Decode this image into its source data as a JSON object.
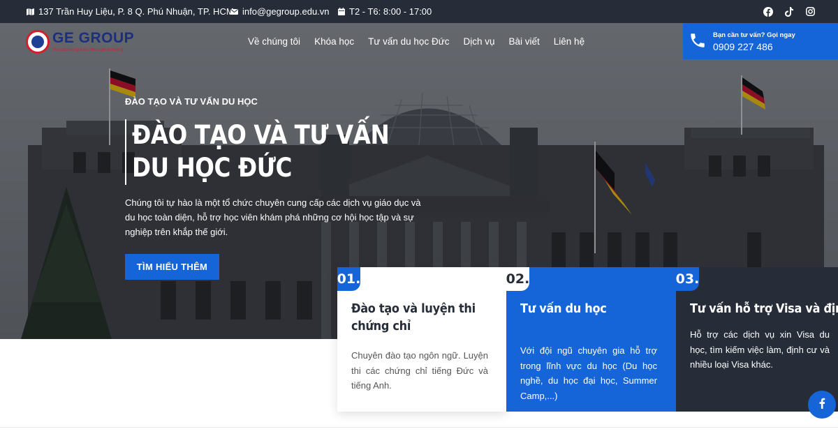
{
  "topbar": {
    "address": "137 Trần Huy Liệu, P. 8 Q. Phú Nhuận, TP. HCM",
    "email": "info@gegroup.edu.vn",
    "hours": "T2 - T6: 8:00 - 17:00",
    "social": [
      "facebook-icon",
      "tiktok-icon",
      "instagram-icon"
    ]
  },
  "logo": {
    "name": "GE GROUP",
    "tagline": "Transforming lives through learning"
  },
  "nav": {
    "items": [
      "Về chúng tôi",
      "Khóa học",
      "Tư vấn du học Đức",
      "Dịch vụ",
      "Bài viết",
      "Liên hệ"
    ]
  },
  "call": {
    "prompt": "Bạn cần tư vấn? Gọi ngay",
    "phone": "0909 227 486"
  },
  "hero": {
    "eyebrow": "ĐÀO TẠO VÀ TƯ VẤN DU HỌC",
    "title": "ĐÀO TẠO VÀ TƯ VẤN DU HỌC ĐỨC",
    "description": "Chúng tôi tự hào là một tổ chức chuyên cung cấp các dịch vụ giáo dục và du học toàn diện, hỗ trợ học viên khám phá những cơ hội học tập và sự nghiệp trên khắp thế giới.",
    "cta": "TÌM HIỂU THÊM"
  },
  "cards": [
    {
      "num": "01.",
      "title": "Đào tạo và luyện thi chứng chỉ",
      "desc": "Chuyên đào tạo ngôn ngữ. Luyện thi các chứng chỉ tiếng Đức và tiếng Anh."
    },
    {
      "num": "02.",
      "title": "Tư vấn du học",
      "desc": "Với đội ngũ chuyên gia hỗ trợ trong lĩnh vực du học (Du học nghề, du học đại học, Summer Camp,...)"
    },
    {
      "num": "03.",
      "title": "Tư vấn hỗ trợ Visa và định cư",
      "desc": "Hỗ trợ các dịch vụ xin Visa du học, tìm kiếm việc làm, định cư và nhiều loại Visa khác."
    }
  ],
  "colors": {
    "primary": "#1565d8",
    "dark": "#262d38"
  }
}
